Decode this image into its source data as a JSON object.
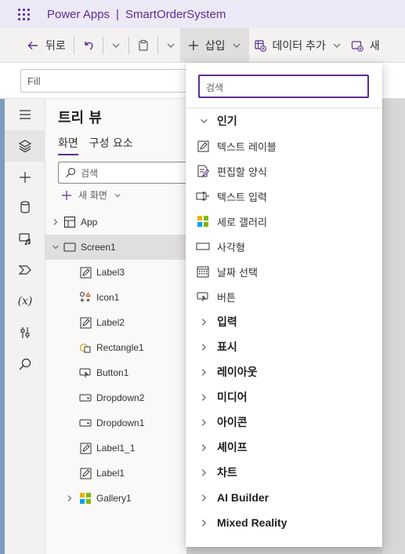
{
  "app": {
    "product": "Power Apps",
    "separator": "|",
    "app_name": "SmartOrderSystem"
  },
  "toolbar": {
    "back_label": "뒤로",
    "insert_label": "삽입",
    "add_data_label": "데이터 추가",
    "new_label": "새"
  },
  "formula": {
    "property": "Fill"
  },
  "tree_view": {
    "title": "트리 뷰",
    "tabs": [
      {
        "label": "화면",
        "active": true
      },
      {
        "label": "구성 요소",
        "active": false
      }
    ],
    "search_placeholder": "검색",
    "new_screen_label": "새 화면",
    "items": [
      {
        "label": "App",
        "icon": "app-icon",
        "level": 0,
        "expandable": true,
        "expanded": false
      },
      {
        "label": "Screen1",
        "icon": "screen-icon",
        "level": 0,
        "expandable": true,
        "expanded": true,
        "selected": true
      },
      {
        "label": "Label3",
        "icon": "label-icon",
        "level": 1
      },
      {
        "label": "Icon1",
        "icon": "icon-control-icon",
        "level": 1
      },
      {
        "label": "Label2",
        "icon": "label-icon",
        "level": 1
      },
      {
        "label": "Rectangle1",
        "icon": "shape-icon",
        "level": 1
      },
      {
        "label": "Button1",
        "icon": "button-icon",
        "level": 1
      },
      {
        "label": "Dropdown2",
        "icon": "dropdown-icon",
        "level": 1
      },
      {
        "label": "Dropdown1",
        "icon": "dropdown-icon",
        "level": 1
      },
      {
        "label": "Label1_1",
        "icon": "label-icon",
        "level": 1
      },
      {
        "label": "Label1",
        "icon": "label-icon",
        "level": 1
      },
      {
        "label": "Gallery1",
        "icon": "gallery-icon",
        "level": 1,
        "expandable": true,
        "expanded": false
      }
    ]
  },
  "insert_panel": {
    "search_placeholder": "검색",
    "popular": {
      "label": "인기",
      "items": [
        {
          "label": "텍스트 레이블",
          "icon": "label-icon"
        },
        {
          "label": "편집할 양식",
          "icon": "edit-form-icon"
        },
        {
          "label": "텍스트 입력",
          "icon": "text-input-icon"
        },
        {
          "label": "세로 갤러리",
          "icon": "gallery-icon"
        },
        {
          "label": "사각형",
          "icon": "rectangle-icon"
        },
        {
          "label": "날짜 선택",
          "icon": "calendar-icon"
        },
        {
          "label": "버튼",
          "icon": "button-icon"
        }
      ]
    },
    "categories": [
      {
        "label": "입력"
      },
      {
        "label": "표시"
      },
      {
        "label": "레이아웃"
      },
      {
        "label": "미디어"
      },
      {
        "label": "아이콘"
      },
      {
        "label": "셰이프"
      },
      {
        "label": "차트"
      },
      {
        "label": "AI Builder"
      },
      {
        "label": "Mixed Reality"
      }
    ]
  },
  "colors": {
    "brand": "#5c2d91",
    "appbar_bg": "#ece9f6",
    "rail_accent": "#7b9bbf"
  }
}
